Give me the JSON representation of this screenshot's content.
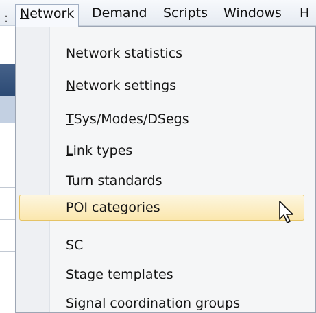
{
  "menubar": {
    "items": [
      {
        "label": "Network",
        "underline": "N",
        "rest": "etwork",
        "open": true
      },
      {
        "label": "Demand",
        "underline": "D",
        "rest": "emand"
      },
      {
        "label": "Scripts",
        "underline": "",
        "rest": "Scripts"
      },
      {
        "label": "Windows",
        "underline": "W",
        "rest": "indows"
      },
      {
        "label": "H",
        "underline": "H",
        "rest": ""
      }
    ]
  },
  "menu": {
    "items": [
      {
        "label": "Network statistics"
      },
      {
        "label": "Network settings",
        "underline": "N",
        "rest": "etwork settings"
      },
      {
        "label": "TSys/Modes/DSegs",
        "underline": "T",
        "rest": "Sys/Modes/DSegs"
      },
      {
        "label": "Link types",
        "underline": "L",
        "rest": "ink types"
      },
      {
        "label": "Turn standards"
      },
      {
        "label": "POI categories",
        "highlighted": true
      },
      {
        "label": "SC"
      },
      {
        "label": "Stage templates"
      },
      {
        "label": "Signal coordination groups"
      }
    ]
  },
  "colors": {
    "highlight_fill": "#fbe7ae",
    "highlight_border": "#e5c365",
    "menu_bg": "#f5f6f7"
  },
  "cursor": {
    "icon": "arrow-pointer-icon"
  }
}
